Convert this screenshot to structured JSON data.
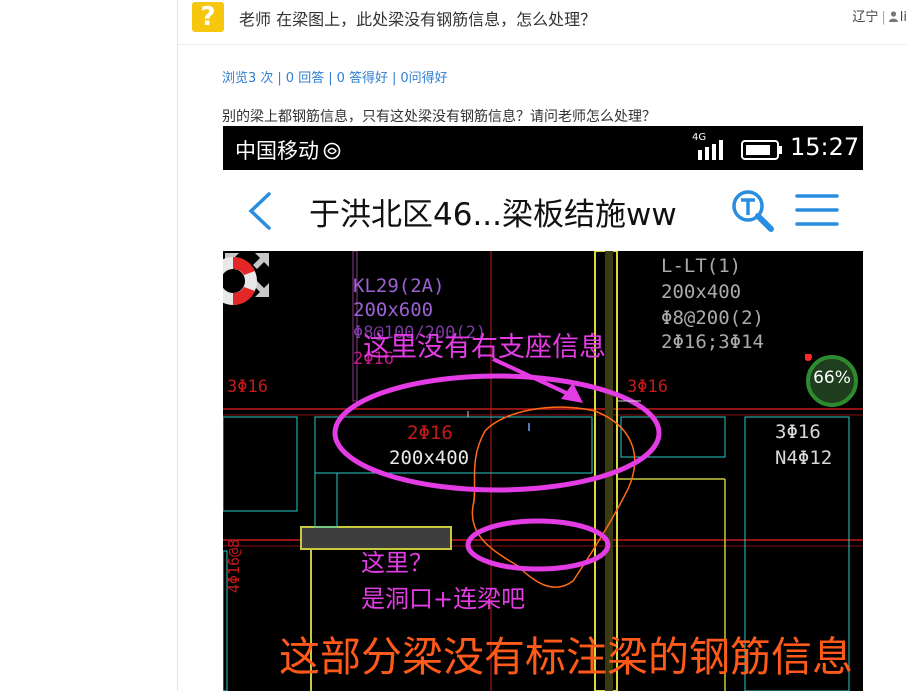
{
  "question": {
    "badge": "?",
    "title": "老师 在梁图上，此处梁没有钢筋信息，怎么处理？",
    "region": "辽宁",
    "separator": "|",
    "user_truncated": "li"
  },
  "stats": {
    "views": "浏览3 次",
    "answers": "0 回答",
    "good_answers": "0 答得好",
    "good_questions": "0问得好"
  },
  "description": "别的梁上都钢筋信息，只有这处梁没有钢筋信息？请问老师怎么处理？",
  "phone": {
    "carrier": "中国移动",
    "network": "4G",
    "time": "15:27",
    "doc_title": "于洪北区46...梁板结施ww"
  },
  "cad": {
    "zoom": "66%",
    "labels": {
      "kl_name": "KL29(2A)",
      "kl_size": "200x600",
      "kl_stirrup": "Φ8@100/200(2)",
      "kl_bars": "2Φ16",
      "lt_name": "L-LT(1)",
      "lt_size": "200x400",
      "lt_stirrup": "Φ8@200(2)",
      "lt_bars": "2Φ16;3Φ14",
      "left_bars": "3Φ16",
      "mid_bars": "3Φ16",
      "right_bars": "4Φ",
      "beam_bars": "2Φ16",
      "beam_size": "200x400",
      "col_bars": "3Φ16",
      "col_n": "N4Φ12",
      "vertical_text": "4Φ16@8"
    },
    "annotations": {
      "no_support": "这里没有右支座信息",
      "here": "这里？",
      "opening": "是洞口+连梁吧",
      "big_note": "这部分梁没有标注梁的钢筋信息"
    }
  },
  "colors": {
    "badge": "#f7c70e",
    "link": "#2f7fd1",
    "annotation_magenta": "#e43ce4",
    "annotation_orange": "#ff5a1a",
    "cad_background": "#000000",
    "app_icon_blue": "#2a8ee0"
  },
  "icons": {
    "question_badge": "question-mark-icon",
    "user": "user-icon",
    "carrier_status": "no-disturb-icon",
    "signal": "signal-icon",
    "battery": "battery-icon",
    "back": "chevron-left-icon",
    "zoom": "magnifier-icon",
    "menu": "hamburger-menu-icon",
    "expand": "expand-arrows-icon",
    "assistant": "lifebuoy-icon"
  }
}
